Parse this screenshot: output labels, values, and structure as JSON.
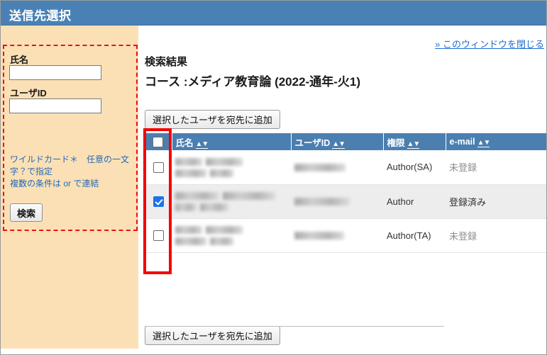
{
  "window": {
    "title": "送信先選択"
  },
  "close_link": {
    "label": "» このウィンドウを閉じる"
  },
  "sidebar": {
    "name_label": "氏名",
    "name_value": "",
    "name_placeholder": "",
    "userid_label": "ユーザID",
    "userid_value": "",
    "userid_placeholder": "",
    "hint_line_1": "ワイルドカード＊　任意の一文字？で指定",
    "hint_line_2": "複数の条件は or で連結",
    "search_button_label": "検索"
  },
  "main": {
    "result_heading": "検索結果",
    "course_heading": "コース :メディア教育論 (2022-通年-火1)",
    "add_button_top_label": "選択したユーザを宛先に追加",
    "add_button_bottom_label": "選択したユーザを宛先に追加"
  },
  "table": {
    "sort_arrows": "▲▼",
    "header_select_all_checked": false,
    "columns": [
      {
        "key": "check",
        "label": ""
      },
      {
        "key": "name",
        "label": "氏名"
      },
      {
        "key": "uid",
        "label": "ユーザID"
      },
      {
        "key": "role",
        "label": "権限"
      },
      {
        "key": "mail",
        "label": "e-mail"
      }
    ],
    "rows": [
      {
        "checked": false,
        "name_redacted": true,
        "uid_redacted": true,
        "role": "Author(SA)",
        "role_suffix": "",
        "mail": "未登録",
        "mail_state": "unregistered"
      },
      {
        "checked": true,
        "name_redacted": true,
        "uid_redacted": true,
        "role": "Author",
        "role_suffix": "",
        "mail": "登録済み",
        "mail_state": "registered"
      },
      {
        "checked": false,
        "name_redacted": true,
        "uid_redacted": true,
        "role": "Author(TA)",
        "role_suffix": "",
        "mail": "未登録",
        "mail_state": "unregistered"
      }
    ]
  },
  "colors": {
    "titlebar": "#4a81b4",
    "sidebar": "#fbe0b5",
    "table_header": "#4a7fb0",
    "link": "#1f6fd0",
    "highlight_red": "#f50000",
    "checkbox_checked": "#1a73e8",
    "row_alt": "#ededed"
  }
}
